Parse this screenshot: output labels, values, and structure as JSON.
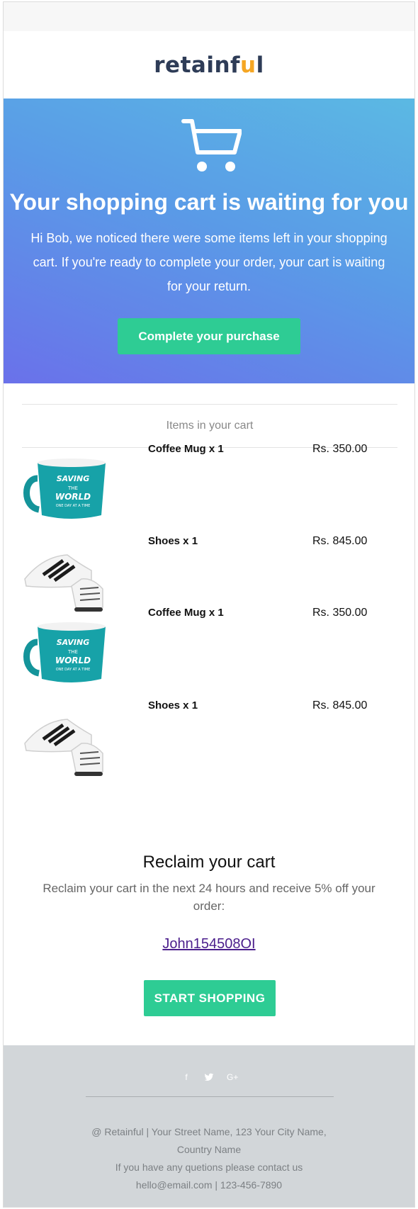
{
  "brand": {
    "name_prefix": "retainf",
    "name_accent": "u",
    "name_suffix": "l"
  },
  "hero": {
    "title": "Your shopping cart is waiting for you",
    "text": "Hi Bob, we noticed there were some items left in your shopping cart. If you're ready to complete your order, your cart is waiting for your return.",
    "button_label": "Complete your purchase"
  },
  "cart": {
    "heading": "Items in your cart",
    "items": [
      {
        "name": "Coffee Mug x 1",
        "price": "Rs. 350.00",
        "image": "coffee-mug"
      },
      {
        "name": "Shoes x 1",
        "price": "Rs. 845.00",
        "image": "sneakers"
      },
      {
        "name": "Coffee Mug x 1",
        "price": "Rs. 350.00",
        "image": "coffee-mug"
      },
      {
        "name": "Shoes x 1",
        "price": "Rs. 845.00",
        "image": "sneakers"
      }
    ],
    "mug_print": {
      "line1": "SAVING",
      "line2": "THE",
      "line3": "WORLD",
      "line4": "ONE DAY AT A TIME"
    }
  },
  "reclaim": {
    "title": "Reclaim your cart",
    "text": "Reclaim your cart in the next 24 hours and receive 5% off your order:",
    "coupon_code": "John154508OI",
    "button_label": "START SHOPPING"
  },
  "footer": {
    "social": [
      "facebook-icon",
      "twitter-icon",
      "google-plus-icon"
    ],
    "address_line1": "@ Retainful | Your Street Name, 123 Your City Name,",
    "address_line2": "Country Name",
    "contact_line": "If you have any quetions please contact us",
    "contact_info": "hello@email.com | 123-456-7890"
  },
  "colors": {
    "accent": "#2ecc94",
    "hero_start": "#5bb9e3",
    "hero_end": "#6a71ea",
    "footer_bg": "#d2d6d9"
  }
}
